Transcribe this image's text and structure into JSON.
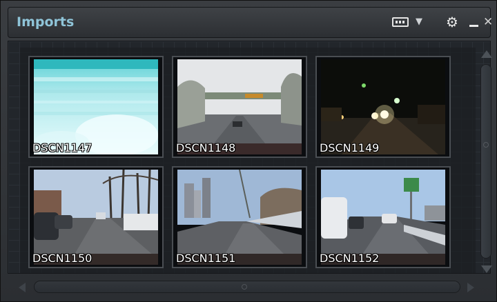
{
  "window": {
    "title": "Imports",
    "icons": {
      "grid_toggle": "grid-view-icon",
      "dropdown": "chevron-down-icon",
      "settings": "gears-icon",
      "minimize": "minimize-icon",
      "close": "close-icon"
    },
    "glyphs": {
      "dropdown": "▼",
      "settings": "⚙",
      "close": "✕"
    }
  },
  "thumbnails": [
    {
      "label": "DSCN1147",
      "scene": "frosted-windshield"
    },
    {
      "label": "DSCN1148",
      "scene": "highway-overpass-overcast"
    },
    {
      "label": "DSCN1149",
      "scene": "road-at-night"
    },
    {
      "label": "DSCN1150",
      "scene": "street-parked-cars"
    },
    {
      "label": "DSCN1151",
      "scene": "highway-city-buildings"
    },
    {
      "label": "DSCN1152",
      "scene": "highway-green-sign"
    }
  ],
  "colors": {
    "title": "#8fc4d8",
    "panel_bg": "#22262b",
    "thumb_border": "#4a4e53"
  }
}
